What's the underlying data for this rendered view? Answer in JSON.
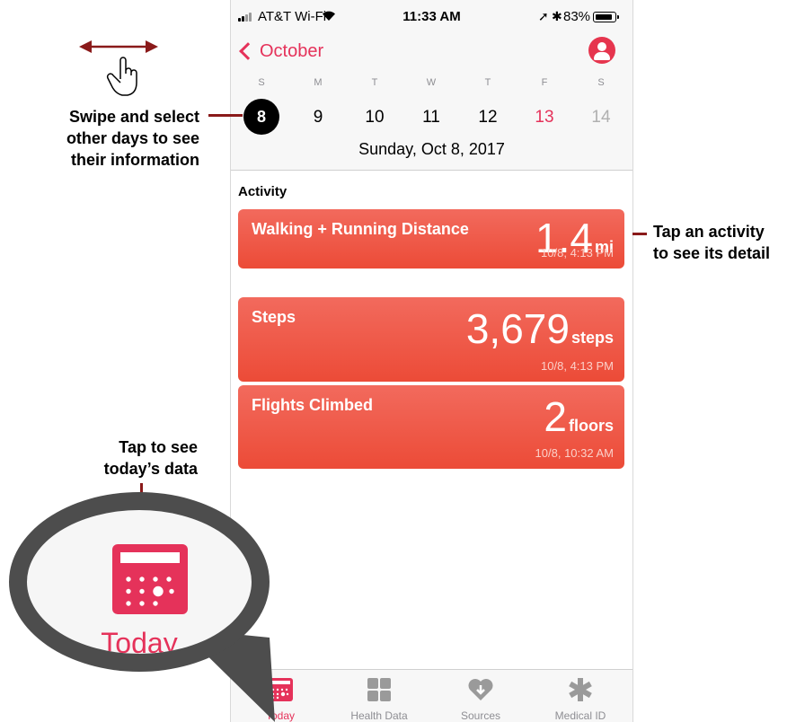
{
  "status_bar": {
    "carrier": "AT&T Wi-Fi",
    "time": "11:33 AM",
    "battery": "83%",
    "battery_level": 0.83
  },
  "nav": {
    "back_label": "October"
  },
  "calendar": {
    "weekdays": [
      "S",
      "M",
      "T",
      "W",
      "T",
      "F",
      "S"
    ],
    "days": [
      "8",
      "9",
      "10",
      "11",
      "12",
      "13",
      "14"
    ],
    "selected_date": "Sunday, Oct 8, 2017"
  },
  "activity": {
    "title": "Activity",
    "cards": [
      {
        "name": "Walking + Running Distance",
        "value": "1.4",
        "unit": "mi",
        "time": "10/8, 4:13 PM"
      },
      {
        "name": "Steps",
        "value": "3,679",
        "unit": "steps",
        "time": "10/8, 4:13 PM"
      },
      {
        "name": "Flights Climbed",
        "value": "2",
        "unit": "floors",
        "time": "10/8, 10:32 AM"
      }
    ]
  },
  "tabs": [
    {
      "label": "Today",
      "icon": "calendar-icon"
    },
    {
      "label": "Health Data",
      "icon": "grid-icon"
    },
    {
      "label": "Sources",
      "icon": "heart-download-icon"
    },
    {
      "label": "Medical ID",
      "icon": "asterisk-icon"
    }
  ],
  "callouts": {
    "swipe_line1": "Swipe and select",
    "swipe_line2": "other days to see",
    "swipe_line3": "their information",
    "activity_line1": "Tap an activity",
    "activity_line2": "to see its detail",
    "today_line1": "Tap to see",
    "today_line2": "today’s data",
    "zoom_label": "Today"
  },
  "colors": {
    "accent": "#e5325a",
    "card": "#ee5a48",
    "callout_line": "#8a1a1a",
    "bubble_border": "#4d4d4d"
  }
}
